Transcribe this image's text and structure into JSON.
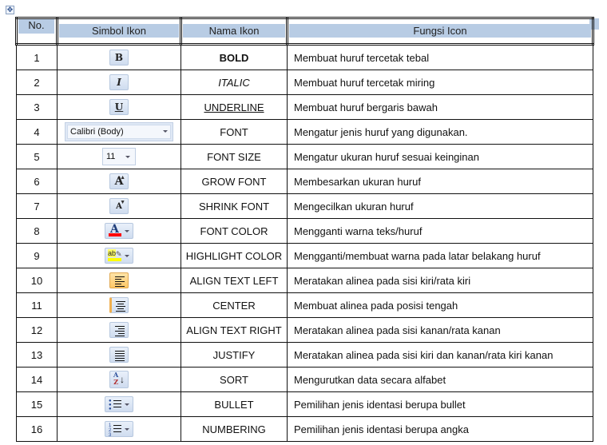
{
  "table": {
    "headers": {
      "no": "No.",
      "symbol": "Simbol Ikon",
      "name": "Nama Ikon",
      "function": "Fungsi Icon"
    },
    "rows": [
      {
        "no": "1",
        "icon": "bold-icon",
        "glyph": "B",
        "name": "BOLD",
        "desc": "Membuat huruf tercetak tebal"
      },
      {
        "no": "2",
        "icon": "italic-icon",
        "glyph": "I",
        "name": "ITALIC",
        "desc": "Membuat huruf tercetak miring"
      },
      {
        "no": "3",
        "icon": "underline-icon",
        "glyph": "U",
        "name": "UNDERLINE",
        "desc": "Membuat huruf bergaris bawah"
      },
      {
        "no": "4",
        "icon": "font-dropdown",
        "glyph": "Calibri (Body)",
        "name": "FONT",
        "desc": "Mengatur jenis huruf yang digunakan."
      },
      {
        "no": "5",
        "icon": "font-size-dropdown",
        "glyph": "11",
        "name": "FONT SIZE",
        "desc": "Mengatur ukuran huruf sesuai keinginan"
      },
      {
        "no": "6",
        "icon": "grow-font-icon",
        "glyph": "A",
        "name": "GROW FONT",
        "desc": "Membesarkan ukuran huruf"
      },
      {
        "no": "7",
        "icon": "shrink-font-icon",
        "glyph": "A",
        "name": "SHRINK FONT",
        "desc": "Mengecilkan ukuran huruf"
      },
      {
        "no": "8",
        "icon": "font-color-icon",
        "glyph": "A",
        "name": "FONT COLOR",
        "desc": "Mengganti warna teks/huruf"
      },
      {
        "no": "9",
        "icon": "highlight-color-icon",
        "glyph": "ab",
        "name": "HIGHLIGHT COLOR",
        "desc": "Mengganti/membuat warna pada latar belakang huruf"
      },
      {
        "no": "10",
        "icon": "align-left-icon",
        "glyph": "",
        "name": "ALIGN TEXT LEFT",
        "desc": "Meratakan alinea pada sisi kiri/rata kiri"
      },
      {
        "no": "11",
        "icon": "align-center-icon",
        "glyph": "",
        "name": "CENTER",
        "desc": "Membuat alinea pada posisi tengah"
      },
      {
        "no": "12",
        "icon": "align-right-icon",
        "glyph": "",
        "name": "ALIGN TEXT RIGHT",
        "desc": "Meratakan alinea pada sisi kanan/rata kanan"
      },
      {
        "no": "13",
        "icon": "justify-icon",
        "glyph": "",
        "name": "JUSTIFY",
        "desc": "Meratakan alinea pada sisi kiri dan kanan/rata kiri kanan"
      },
      {
        "no": "14",
        "icon": "sort-icon",
        "glyph": "AZ",
        "name": "SORT",
        "desc": "Mengurutkan data secara alfabet"
      },
      {
        "no": "15",
        "icon": "bullets-icon",
        "glyph": "",
        "name": "BULLET",
        "desc": "Pemilihan jenis identasi berupa bullet"
      },
      {
        "no": "16",
        "icon": "numbering-icon",
        "glyph": "",
        "name": "NUMBERING",
        "desc": "Pemilihan jenis identasi berupa angka"
      }
    ]
  },
  "colors": {
    "header_shade": "#b8cce4",
    "font_color_bar": "#ff0000",
    "highlight_bar": "#ffff00",
    "active_button": "#ffc866"
  }
}
